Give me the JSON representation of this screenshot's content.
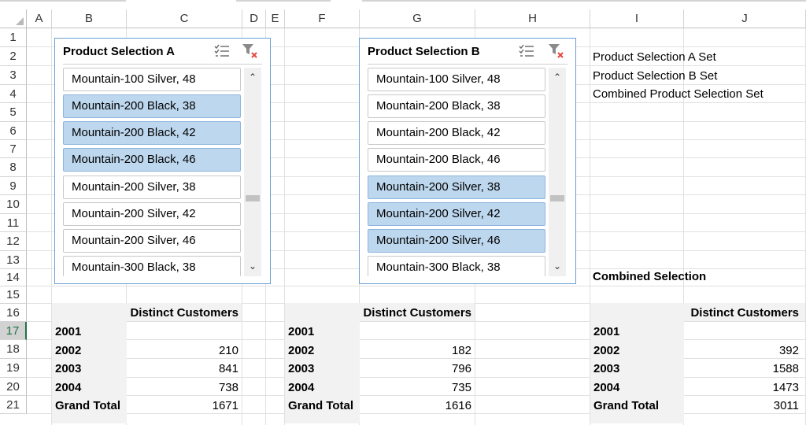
{
  "columns": [
    "A",
    "B",
    "C",
    "D",
    "E",
    "F",
    "G",
    "H",
    "I",
    "J"
  ],
  "rows": [
    "1",
    "2",
    "3",
    "4",
    "5",
    "6",
    "7",
    "8",
    "9",
    "10",
    "11",
    "12",
    "13",
    "14",
    "15",
    "16",
    "17",
    "18",
    "19",
    "20",
    "21"
  ],
  "active_row": "17",
  "slicer_a": {
    "title": "Product Selection A",
    "items": [
      {
        "label": "Mountain-100 Silver, 48",
        "selected": false
      },
      {
        "label": "Mountain-200 Black, 38",
        "selected": true
      },
      {
        "label": "Mountain-200 Black, 42",
        "selected": true
      },
      {
        "label": "Mountain-200 Black, 46",
        "selected": true
      },
      {
        "label": "Mountain-200 Silver, 38",
        "selected": false
      },
      {
        "label": "Mountain-200 Silver, 42",
        "selected": false
      },
      {
        "label": "Mountain-200 Silver, 46",
        "selected": false
      },
      {
        "label": "Mountain-300 Black, 38",
        "selected": false
      }
    ],
    "icons": [
      "multi-select-icon",
      "clear-filter-icon"
    ]
  },
  "slicer_b": {
    "title": "Product Selection B",
    "items": [
      {
        "label": "Mountain-100 Silver, 48",
        "selected": false
      },
      {
        "label": "Mountain-200 Black, 38",
        "selected": false
      },
      {
        "label": "Mountain-200 Black, 42",
        "selected": false
      },
      {
        "label": "Mountain-200 Black, 46",
        "selected": false
      },
      {
        "label": "Mountain-200 Silver, 38",
        "selected": true
      },
      {
        "label": "Mountain-200 Silver, 42",
        "selected": true
      },
      {
        "label": "Mountain-200 Silver, 46",
        "selected": true
      },
      {
        "label": "Mountain-300 Black, 38",
        "selected": false
      }
    ],
    "icons": [
      "multi-select-icon",
      "clear-filter-icon"
    ]
  },
  "set_labels": {
    "a": "Product Selection A Set",
    "b": "Product Selection B Set",
    "combined": "Combined Product Selection Set"
  },
  "combined_selection_label": "Combined Selection",
  "pivot_a": {
    "header": "Distinct Customers",
    "rows": [
      {
        "year": "2001",
        "value": ""
      },
      {
        "year": "2002",
        "value": "210"
      },
      {
        "year": "2003",
        "value": "841"
      },
      {
        "year": "2004",
        "value": "738"
      },
      {
        "year": "Grand Total",
        "value": "1671"
      }
    ]
  },
  "pivot_b": {
    "header": "Distinct Customers",
    "rows": [
      {
        "year": "2001",
        "value": ""
      },
      {
        "year": "2002",
        "value": "182"
      },
      {
        "year": "2003",
        "value": "796"
      },
      {
        "year": "2004",
        "value": "735"
      },
      {
        "year": "Grand Total",
        "value": "1616"
      }
    ]
  },
  "pivot_c": {
    "header": "Distinct Customers",
    "rows": [
      {
        "year": "2001",
        "value": ""
      },
      {
        "year": "2002",
        "value": "392"
      },
      {
        "year": "2003",
        "value": "1588"
      },
      {
        "year": "2004",
        "value": "1473"
      },
      {
        "year": "Grand Total",
        "value": "3011"
      }
    ]
  },
  "colors": {
    "selected_item": "#bdd7ee",
    "slicer_border": "#6c9fd3",
    "clear_filter_x": "#e8453c",
    "active_row_text": "#217346"
  }
}
